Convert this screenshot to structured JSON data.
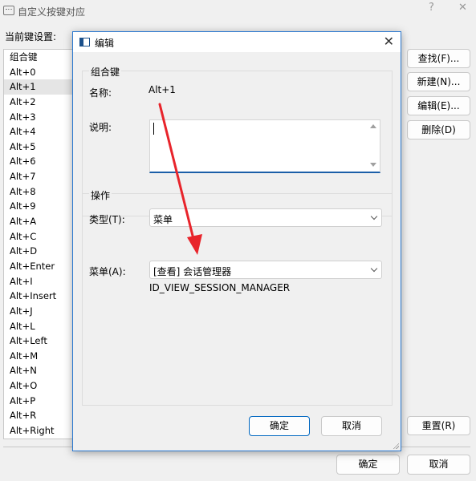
{
  "outer": {
    "title": "自定义按键对应",
    "help_glyph": "?",
    "close_glyph": "✕",
    "current_label": "当前键设置:",
    "list_header": "组合键",
    "list_items": [
      "Alt+0",
      "Alt+1",
      "Alt+2",
      "Alt+3",
      "Alt+4",
      "Alt+5",
      "Alt+6",
      "Alt+7",
      "Alt+8",
      "Alt+9",
      "Alt+A",
      "Alt+C",
      "Alt+D",
      "Alt+Enter",
      "Alt+I",
      "Alt+Insert",
      "Alt+J",
      "Alt+L",
      "Alt+Left",
      "Alt+M",
      "Alt+N",
      "Alt+O",
      "Alt+P",
      "Alt+R",
      "Alt+Right"
    ],
    "selected_item": "Alt+1",
    "buttons": {
      "find": "查找(F)...",
      "new": "新建(N)...",
      "edit": "编辑(E)...",
      "delete": "删除(D)",
      "reset": "重置(R)",
      "ok": "确定",
      "cancel": "取消"
    }
  },
  "dialog": {
    "title": "编辑",
    "close_glyph": "✕",
    "group_key": {
      "label": "组合键",
      "name_label": "名称:",
      "name_value": "Alt+1",
      "desc_label": "说明:",
      "desc_value": ""
    },
    "group_action": {
      "label": "操作",
      "type_label": "类型(T):",
      "type_value": "菜单",
      "menu_label": "菜单(A):",
      "menu_value": "[查看] 会话管理器",
      "menu_id": "ID_VIEW_SESSION_MANAGER"
    },
    "ok": "确定",
    "cancel": "取消"
  },
  "colors": {
    "accent": "#0067c0",
    "annotation_arrow": "#e8242b"
  }
}
